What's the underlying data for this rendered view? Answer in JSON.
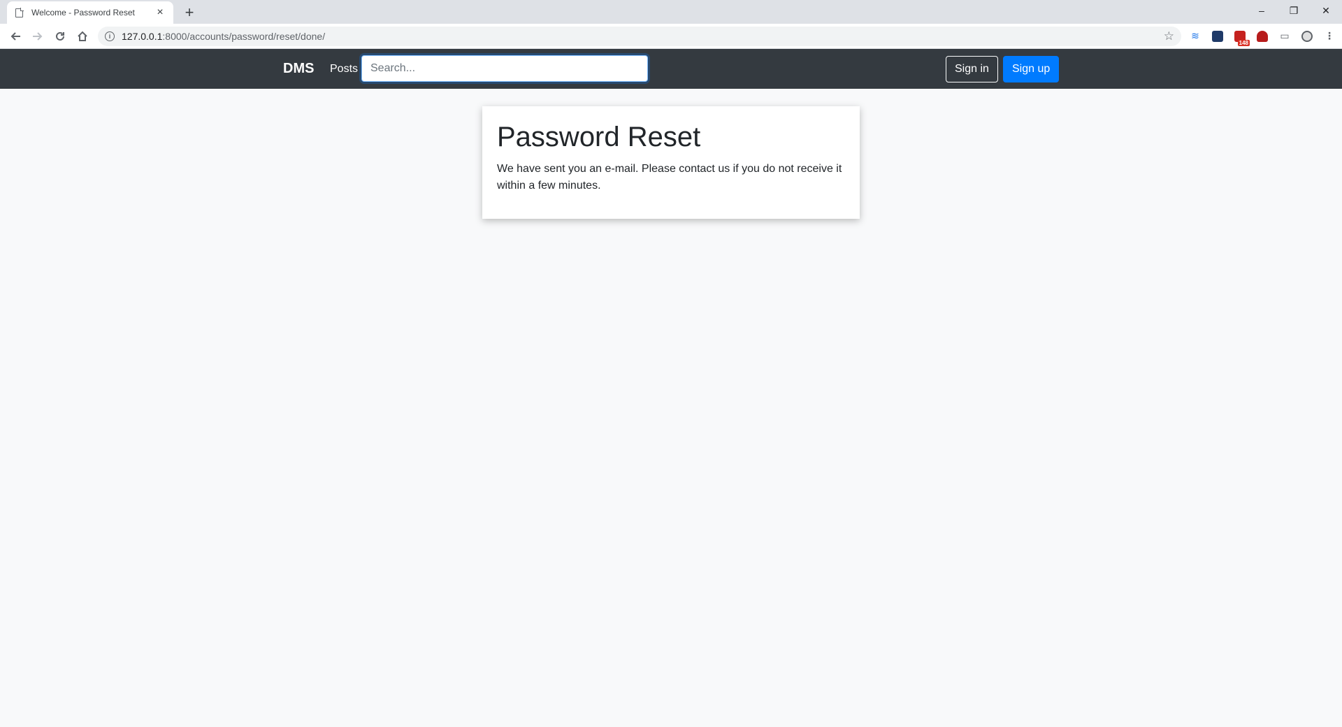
{
  "browser": {
    "tab_title": "Welcome - Password Reset",
    "tab_close": "×",
    "new_tab": "+",
    "url_host": "127.0.0.1",
    "url_path": ":8000/accounts/password/reset/done/",
    "window_controls": {
      "minimize": "–",
      "restore": "❐",
      "close": "✕"
    },
    "extension_badge": "148"
  },
  "navbar": {
    "brand": "DMS",
    "posts_link": "Posts",
    "search_placeholder": "Search...",
    "sign_in": "Sign in",
    "sign_up": "Sign up"
  },
  "card": {
    "title": "Password Reset",
    "message": "We have sent you an e-mail. Please contact us if you do not receive it within a few minutes."
  },
  "colors": {
    "navbar_bg": "#343a40",
    "primary": "#007bff",
    "page_bg": "#f8f9fa"
  }
}
